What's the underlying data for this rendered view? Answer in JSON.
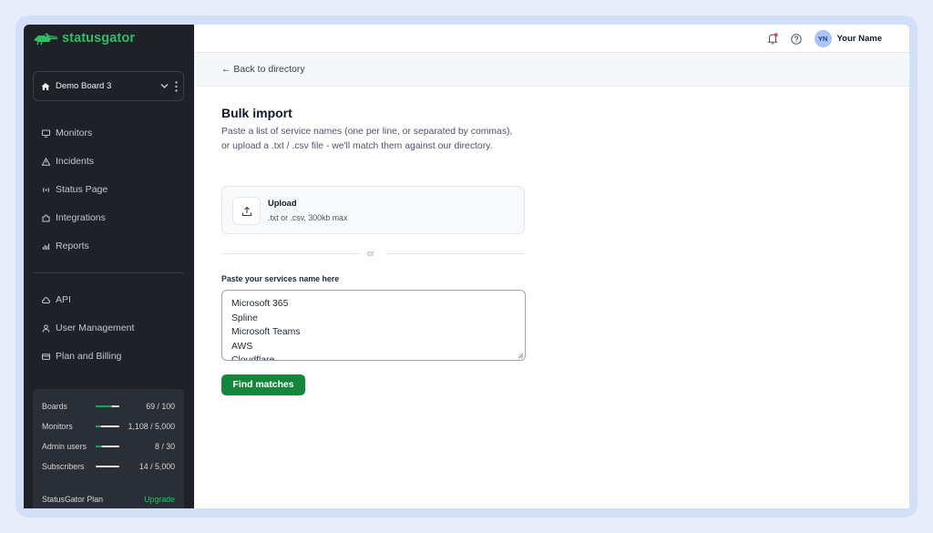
{
  "brand": {
    "name": "statusgator"
  },
  "sidebar": {
    "board": "Demo Board 3",
    "items": [
      {
        "label": "Monitors",
        "icon": "monitor-icon"
      },
      {
        "label": "Incidents",
        "icon": "warning-icon"
      },
      {
        "label": "Status Page",
        "icon": "broadcast-icon"
      },
      {
        "label": "Integrations",
        "icon": "puzzle-icon"
      },
      {
        "label": "Reports",
        "icon": "bar-chart-icon"
      }
    ],
    "items2": [
      {
        "label": "API",
        "icon": "cloud-icon"
      },
      {
        "label": "User Management",
        "icon": "user-icon"
      },
      {
        "label": "Plan and Billing",
        "icon": "credit-card-icon"
      }
    ],
    "usage": [
      {
        "label": "Boards",
        "value": "69 / 100",
        "fill": 0.69
      },
      {
        "label": "Monitors",
        "value": "1,108 / 5,000",
        "fill": 0.22
      },
      {
        "label": "Admin users",
        "value": "8 / 30",
        "fill": 0.27
      },
      {
        "label": "Subscribers",
        "value": "14 / 5,000",
        "fill": 0.003
      }
    ],
    "plan_label": "StatusGator Plan",
    "upgrade_label": "Upgrade"
  },
  "topbar": {
    "avatar_initials": "YN",
    "username": "Your Name"
  },
  "subbar": {
    "back_label": "← Back to directory"
  },
  "main": {
    "title": "Bulk import",
    "description": "Paste a list of service names (one per line, or separated by commas), or upload a .txt / .csv file - we'll match them against our directory.",
    "upload_title": "Upload",
    "upload_sub": ".txt or .csv, 300kb max",
    "or_label": "or",
    "paste_label": "Paste your services name here",
    "services": [
      "Microsoft 365",
      "Spline",
      "Microsoft Teams",
      "AWS",
      "Cloudflare"
    ],
    "find_button": "Find matches"
  },
  "colors": {
    "brand_green": "#2fbf63",
    "button_green": "#14873d",
    "sidebar_bg": "#1e2128"
  }
}
